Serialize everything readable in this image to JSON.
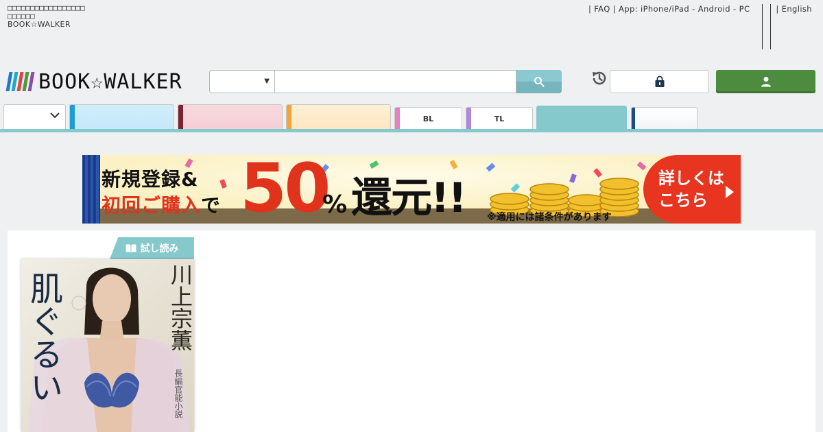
{
  "top": {
    "tagline_tofu_1": "□□□□□□□□□□□□□□□□□",
    "tagline_tofu_2": "□□□□□□",
    "tagline_brand": "BOOK☆WALKER",
    "links": [
      {
        "label": "FAQ"
      },
      {
        "label": "App: iPhone/iPad - Android - PC"
      },
      {
        "label": "English"
      }
    ],
    "separator": "|"
  },
  "header": {
    "logo_text": "BOOK☆WALKER",
    "logo_bar_colors": [
      "#1e7ac9",
      "#1fa8c9",
      "#e0443e",
      "#4b9a3c",
      "#8a4ea6"
    ],
    "search": {
      "select_value": "",
      "placeholder": ""
    },
    "icons": {
      "search": "search-icon",
      "history": "history-icon",
      "cart": "lock-bag-icon",
      "login": "user-icon"
    },
    "accent": "#86c9cd",
    "login_color": "#4d8b3f"
  },
  "tabs": [
    {
      "label": "",
      "strip": ""
    },
    {
      "label": "",
      "strip": "#1a9ed6"
    },
    {
      "label": "",
      "strip": "#7a2332"
    },
    {
      "label": "",
      "strip": "#f5a43b"
    },
    {
      "label": "BL",
      "strip": "#e77fc5"
    },
    {
      "label": "TL",
      "strip": "#b387d8"
    },
    {
      "label": "",
      "strip": ""
    },
    {
      "label": "",
      "strip": "#1b4c88"
    }
  ],
  "banner": {
    "line1": "新規登録&",
    "line2_a": "初回ご購入",
    "line2_b": "で",
    "big": "50",
    "pct": "%",
    "kanji": "還元!!",
    "note": "※適用には諸条件があります",
    "cta_1": "詳しくは",
    "cta_2": "こちら"
  },
  "book": {
    "preview_label": "試し読み",
    "title": "肌ぐるい",
    "author": "川上宗薫",
    "subtitle": "長編官能小説"
  }
}
